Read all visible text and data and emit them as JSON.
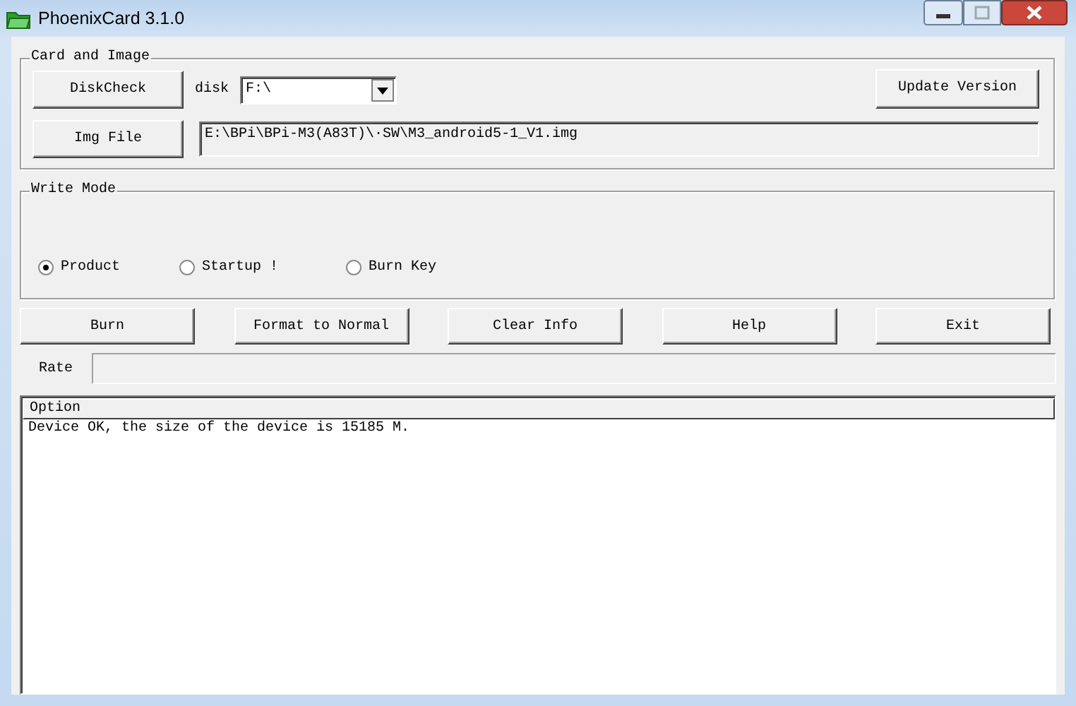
{
  "window": {
    "title": "PhoenixCard 3.1.0"
  },
  "card_and_image": {
    "title": "Card and Image",
    "disk_check_button": "DiskCheck",
    "disk_label": "disk",
    "disk_combo": {
      "value": "F:\\"
    },
    "update_button": "Update Version",
    "img_file_button": "Img File",
    "image_path": "E:\\BPi\\BPi-M3(A83T)\\·SW\\M3_android5-1_V1.img"
  },
  "write_mode": {
    "title": "Write Mode",
    "options": [
      {
        "label": "Product",
        "selected": true
      },
      {
        "label": "Startup !",
        "selected": false
      },
      {
        "label": "Burn Key",
        "selected": false
      }
    ]
  },
  "actions": [
    "Burn",
    "Format to Normal",
    "Clear Info",
    "Help",
    "Exit"
  ],
  "rate": {
    "label": "Rate",
    "level": 0
  },
  "log": {
    "columns": [
      "Option"
    ],
    "lines": [
      "Device OK, the size of the device is 15185 M."
    ]
  }
}
